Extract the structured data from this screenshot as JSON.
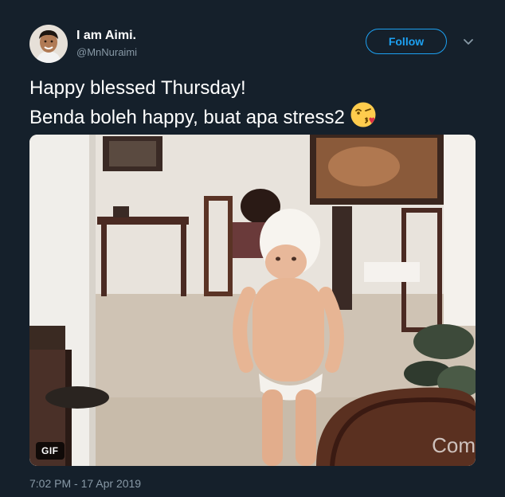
{
  "author": {
    "display_name": "I am Aimi.",
    "handle": "@MnNuraimi"
  },
  "follow_button": {
    "label": "Follow"
  },
  "tweet": {
    "line1": "Happy blessed Thursday!",
    "line2": "Benda boleh happy, buat apa stress2",
    "emoji": "face-blowing-a-kiss-icon"
  },
  "media": {
    "badge": "GIF",
    "watermark": "Com"
  },
  "timestamp": "7:02 PM - 17 Apr 2019",
  "colors": {
    "background": "#15202b",
    "accent": "#1da1f2",
    "secondary_text": "#8899a6"
  }
}
